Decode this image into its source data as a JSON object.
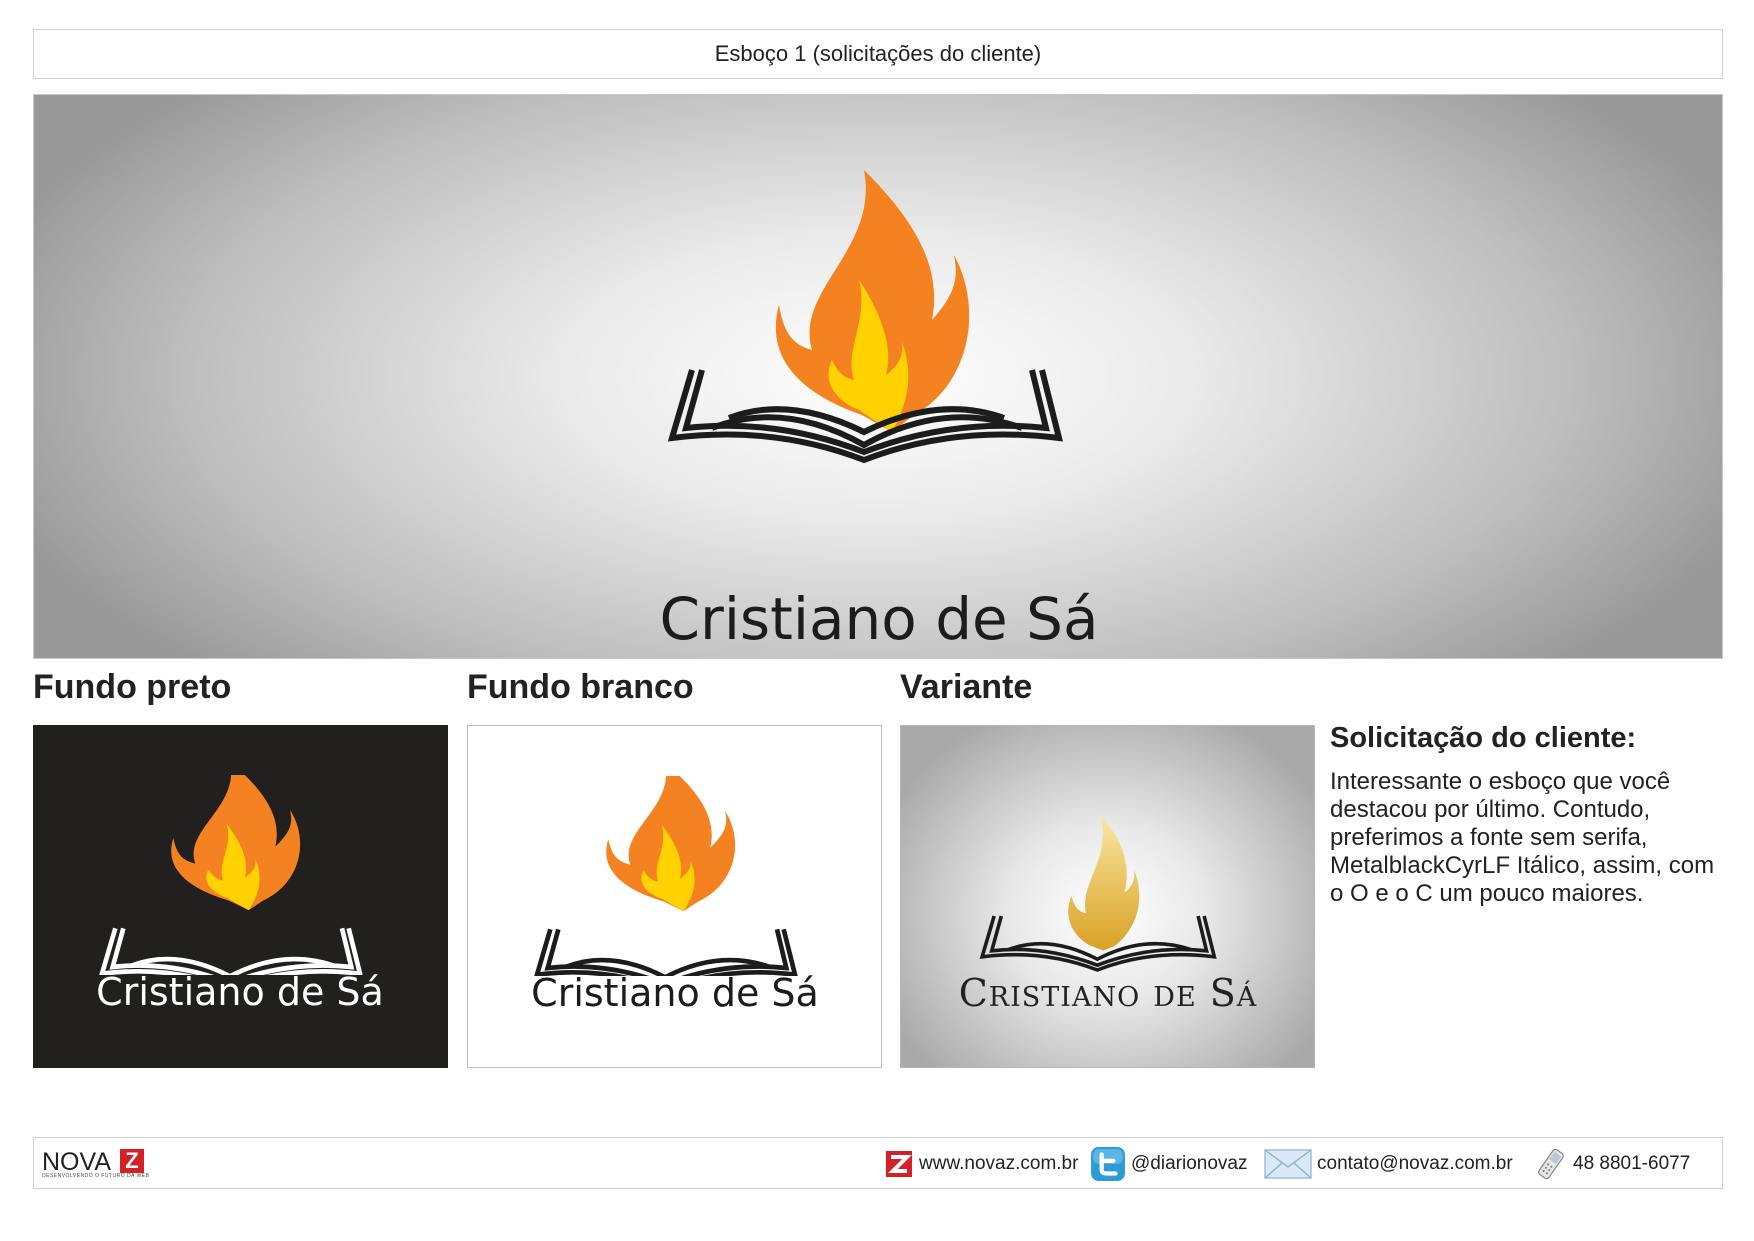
{
  "header": {
    "title": "Esboço 1 (solicitações do cliente)"
  },
  "hero": {
    "wordmark": "Cristiano de Sá"
  },
  "sections": [
    {
      "heading": "Fundo preto",
      "wordmark": "Cristiano de Sá"
    },
    {
      "heading": "Fundo branco",
      "wordmark": "Cristiano de Sá"
    },
    {
      "heading": "Variante",
      "wordmark": "Cristiano de Sá"
    }
  ],
  "request": {
    "title": "Solicitação do cliente:",
    "body": "Interessante o esboço que você destacou por último. Contudo, preferimos a fonte sem serifa, MetalblackCyrLF Itálico, assim, com o O e o C um pouco maiores."
  },
  "footer": {
    "brand": "NOVA",
    "brand_mark": "Z",
    "brand_tagline": "DESENVOLVENDO O FUTURO DA WEB",
    "website": "www.novaz.com.br",
    "twitter": "@diarionovaz",
    "email": "contato@novaz.com.br",
    "phone": "48 8801-6077"
  },
  "colors": {
    "flame_orange": "#f58220",
    "flame_yellow": "#ffd200",
    "flame_gold": "#e8b23a",
    "book_dark": "#1c1c1c",
    "brand_red": "#d42027",
    "twitter_blue": "#2e9bd6"
  },
  "icons": [
    "novaz-logo-icon",
    "twitter-icon",
    "mail-icon",
    "phone-icon"
  ]
}
